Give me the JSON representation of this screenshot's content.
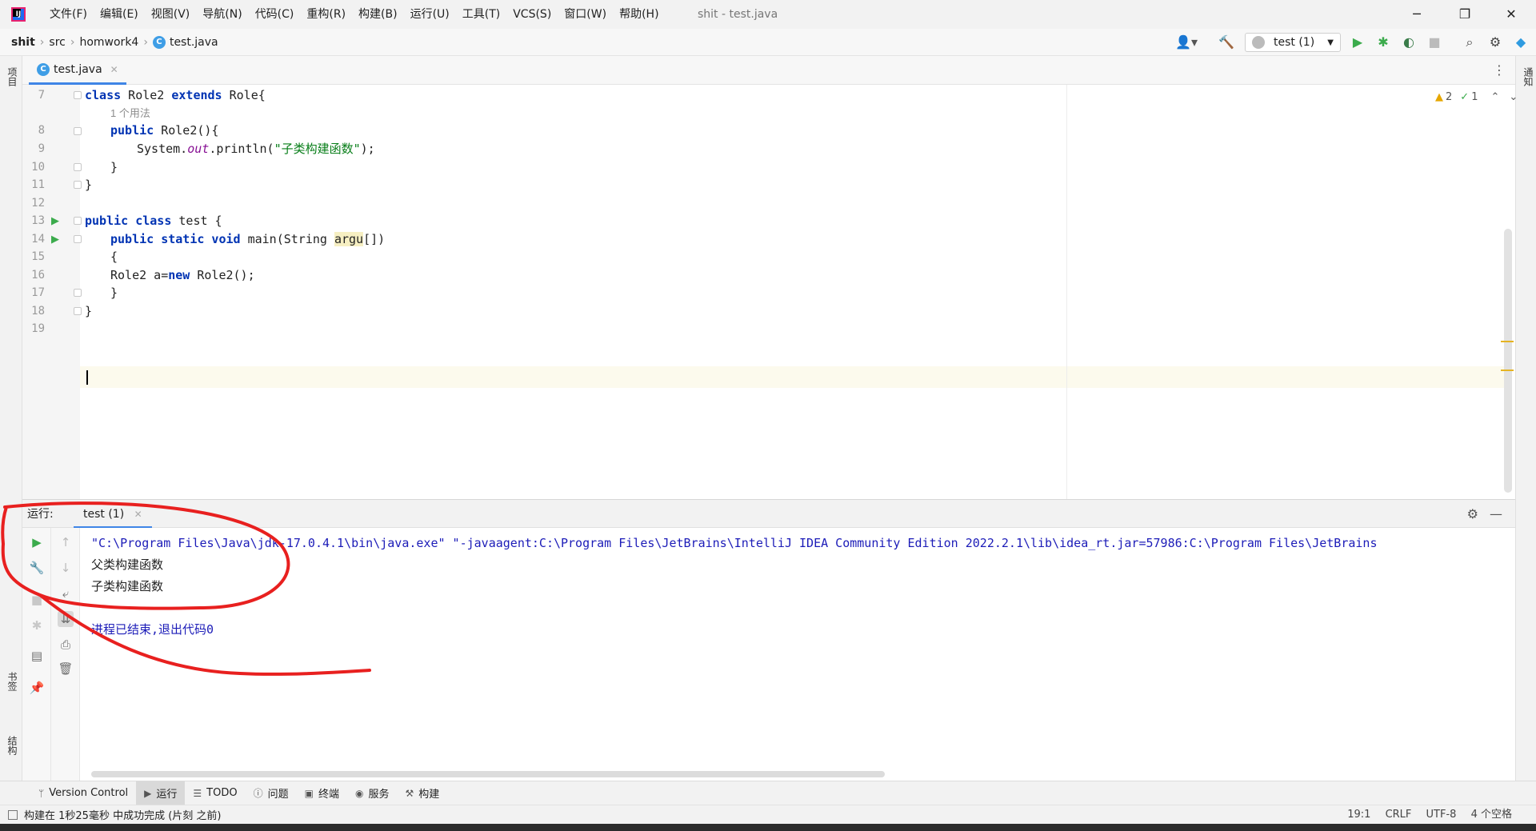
{
  "window": {
    "title": "shit - test.java",
    "minimize": "─",
    "maximize": "❐",
    "close": "✕"
  },
  "menu": [
    "文件(F)",
    "编辑(E)",
    "视图(V)",
    "导航(N)",
    "代码(C)",
    "重构(R)",
    "构建(B)",
    "运行(U)",
    "工具(T)",
    "VCS(S)",
    "窗口(W)",
    "帮助(H)"
  ],
  "breadcrumb": [
    "shit",
    "src",
    "homwork4",
    "test.java"
  ],
  "toolbar": {
    "run_config": "test (1)"
  },
  "side_panels": {
    "project": "项目",
    "bookmarks": "书签",
    "structure": "结构",
    "notifications": "通知"
  },
  "editor": {
    "tab": "test.java",
    "inspections": {
      "warnings": "2",
      "typos": "1"
    },
    "lines": [
      {
        "no": "7"
      },
      {
        "no": ""
      },
      {
        "no": "8"
      },
      {
        "no": "9"
      },
      {
        "no": "10"
      },
      {
        "no": "11"
      },
      {
        "no": "12"
      },
      {
        "no": "13"
      },
      {
        "no": "14"
      },
      {
        "no": "15"
      },
      {
        "no": "16"
      },
      {
        "no": "17"
      },
      {
        "no": "18"
      },
      {
        "no": "19"
      }
    ],
    "code": {
      "l7": {
        "kw1": "class",
        "t1": " Role2 ",
        "kw2": "extends",
        "t2": " Role{"
      },
      "hint": "1 个用法",
      "l8": {
        "kw1": "public",
        "t1": " Role2(){"
      },
      "l9": {
        "t1": "System.",
        "field": "out",
        "t2": ".println(",
        "str": "\"子类构建函数\"",
        "t3": ");"
      },
      "l10": "}",
      "l11": "}",
      "l13": {
        "kw1": "public class",
        "t1": " test {"
      },
      "l14": {
        "kw1": "public static void",
        "t1": " main(String ",
        "param": "argu",
        "t2": "[])"
      },
      "l15": "{",
      "l16": {
        "t1": "Role2 a=",
        "kw1": "new",
        "t2": " Role2();"
      },
      "l17": "}",
      "l18": "}"
    }
  },
  "run": {
    "label": "运行:",
    "tab": "test (1)",
    "console": {
      "command": "\"C:\\Program Files\\Java\\jdk-17.0.4.1\\bin\\java.exe\" \"-javaagent:C:\\Program Files\\JetBrains\\IntelliJ IDEA Community Edition 2022.2.1\\lib\\idea_rt.jar=57986:C:\\Program Files\\JetBrains",
      "output": [
        "父类构建函数",
        "子类构建函数"
      ],
      "exit": "进程已结束,退出代码0"
    }
  },
  "bottom_tools": [
    "Version Control",
    "运行",
    "TODO",
    "问题",
    "终端",
    "服务",
    "构建"
  ],
  "status": {
    "message": "构建在 1秒25毫秒 中成功完成 (片刻 之前)",
    "position": "19:1",
    "line_sep": "CRLF",
    "encoding": "UTF-8",
    "indent": "4 个空格"
  }
}
